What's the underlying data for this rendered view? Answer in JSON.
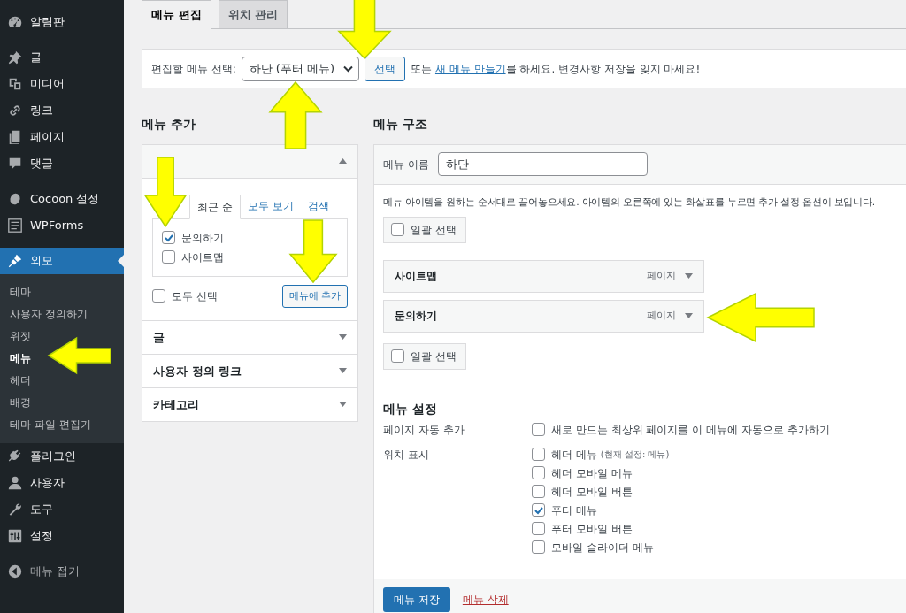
{
  "sidebar": {
    "groups": [
      {
        "items": [
          {
            "label": "알림판",
            "selected": false
          }
        ]
      },
      {
        "items": [
          {
            "label": "글",
            "selected": false
          },
          {
            "label": "미디어",
            "selected": false
          },
          {
            "label": "링크",
            "selected": false
          },
          {
            "label": "페이지",
            "selected": false
          },
          {
            "label": "댓글",
            "selected": false
          }
        ]
      },
      {
        "items": [
          {
            "label": "Cocoon 설정",
            "selected": false
          },
          {
            "label": "WPForms",
            "selected": false
          }
        ]
      },
      {
        "items": [
          {
            "label": "외모",
            "selected": true,
            "children": [
              {
                "label": "테마",
                "selected": false
              },
              {
                "label": "사용자 정의하기",
                "selected": false
              },
              {
                "label": "위젯",
                "selected": false
              },
              {
                "label": "메뉴",
                "selected": true
              },
              {
                "label": "헤더",
                "selected": false
              },
              {
                "label": "배경",
                "selected": false
              },
              {
                "label": "테마 파일 편집기",
                "selected": false
              }
            ]
          },
          {
            "label": "플러그인",
            "selected": false
          },
          {
            "label": "사용자",
            "selected": false
          },
          {
            "label": "도구",
            "selected": false
          },
          {
            "label": "설정",
            "selected": false
          }
        ]
      }
    ],
    "collapse": {
      "label": "메뉴 접기"
    }
  },
  "tabs": [
    {
      "label": "메뉴 편집",
      "selected": true
    },
    {
      "label": "위치 관리",
      "selected": false
    }
  ],
  "menu_select": {
    "label": "편집할 메뉴 선택:",
    "value": "하단 (푸터 메뉴)",
    "button": "선택",
    "text_before": "또는 ",
    "link": "새 메뉴 만들기",
    "text_after": "를 하세요. 변경사항 저장을 잊지 마세요!"
  },
  "add_menu": {
    "heading": "메뉴 추가",
    "sections": [
      {
        "expanded": true,
        "tabs": [
          {
            "label": "최근 순",
            "selected": true
          },
          {
            "label": "모두 보기",
            "selected": false
          },
          {
            "label": "검색",
            "selected": false
          }
        ],
        "items": [
          {
            "label": "문의하기",
            "checked": true
          },
          {
            "label": "사이트맵",
            "checked": false
          }
        ],
        "select_all": {
          "label": "모두 선택",
          "checked": false
        },
        "add_button": "메뉴에 추가"
      },
      {
        "title": "글",
        "expanded": false
      },
      {
        "title": "사용자 정의 링크",
        "expanded": false
      },
      {
        "title": "카테고리",
        "expanded": false
      }
    ]
  },
  "structure": {
    "heading": "메뉴 구조",
    "name_label": "메뉴 이름",
    "name_value": "하단",
    "hint": "메뉴 아이템을 원하는 순서대로 끌어놓으세요. 아이템의 오른쪽에 있는 화살표를 누르면 추가 설정 옵션이 보입니다.",
    "bulk_select_top": {
      "label": "일괄 선택",
      "checked": false
    },
    "items": [
      {
        "title": "사이트맵",
        "type": "페이지"
      },
      {
        "title": "문의하기",
        "type": "페이지"
      }
    ],
    "bulk_select_bottom": {
      "label": "일괄 선택",
      "checked": false
    },
    "settings": {
      "heading": "메뉴 설정",
      "auto_add": {
        "label": "페이지 자동 추가",
        "options": [
          {
            "label": "새로 만드는 최상위 페이지를 이 메뉴에 자동으로 추가하기",
            "checked": false
          }
        ]
      },
      "locations": {
        "label": "위치 표시",
        "options": [
          {
            "label": "헤더 메뉴",
            "note": "(현재 설정: 메뉴)",
            "checked": false
          },
          {
            "label": "헤더 모바일 메뉴",
            "checked": false
          },
          {
            "label": "헤더 모바일 버튼",
            "checked": false
          },
          {
            "label": "푸터 메뉴",
            "checked": true
          },
          {
            "label": "푸터 모바일 버튼",
            "checked": false
          },
          {
            "label": "모바일 슬라이더 메뉴",
            "checked": false
          }
        ]
      }
    },
    "save_button": "메뉴 저장",
    "delete_link": "메뉴 삭제"
  }
}
